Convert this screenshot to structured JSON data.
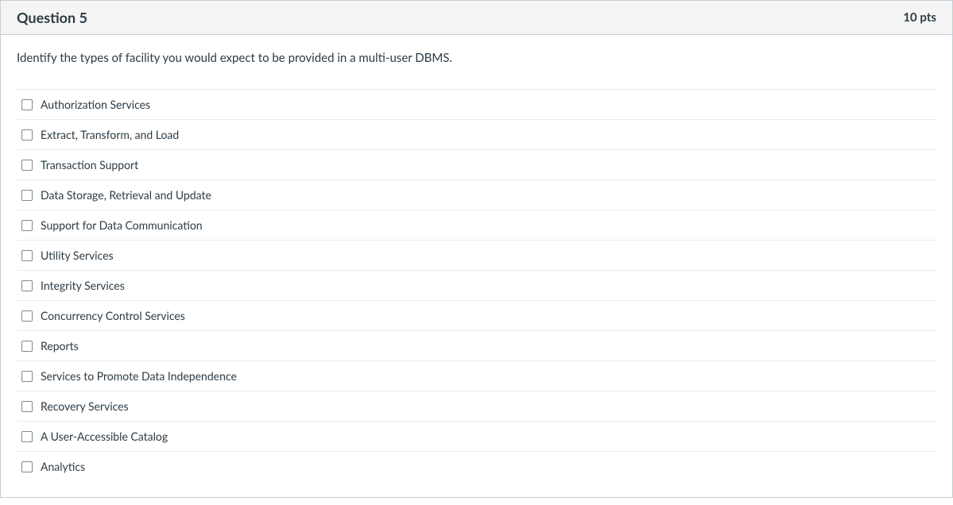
{
  "header": {
    "title": "Question 5",
    "points": "10 pts"
  },
  "body": {
    "prompt": "Identify the types of facility you would expect to be provided in a multi-user DBMS."
  },
  "answers": [
    {
      "label": "Authorization Services"
    },
    {
      "label": "Extract, Transform, and Load"
    },
    {
      "label": "Transaction Support"
    },
    {
      "label": "Data Storage, Retrieval and Update"
    },
    {
      "label": "Support for Data Communication"
    },
    {
      "label": "Utility Services"
    },
    {
      "label": "Integrity Services"
    },
    {
      "label": "Concurrency Control Services"
    },
    {
      "label": "Reports"
    },
    {
      "label": "Services to Promote Data Independence"
    },
    {
      "label": "Recovery Services"
    },
    {
      "label": "A User-Accessible Catalog"
    },
    {
      "label": "Analytics"
    }
  ]
}
